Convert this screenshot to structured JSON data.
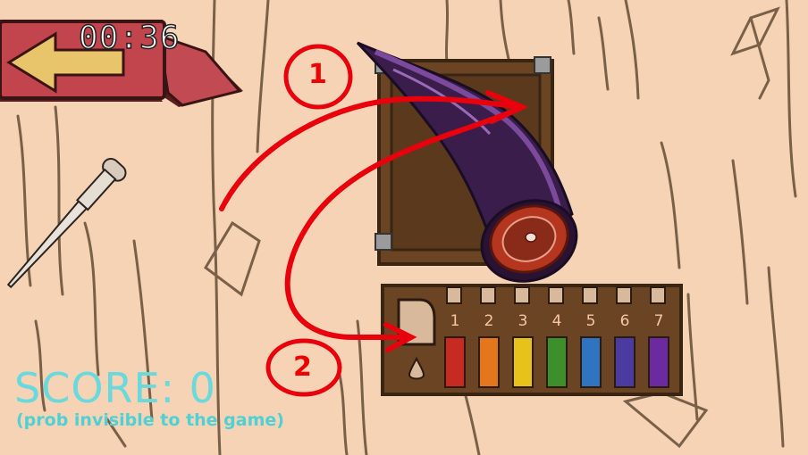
{
  "hud": {
    "timer": "00:36",
    "score_text": "SCORE: 0",
    "score_note": "(prob invisible to the game)"
  },
  "tray": {
    "slots": [
      {
        "label": "1",
        "color": "#c62a22"
      },
      {
        "label": "2",
        "color": "#e4761c"
      },
      {
        "label": "3",
        "color": "#e6c21a"
      },
      {
        "label": "4",
        "color": "#3c8f2a"
      },
      {
        "label": "5",
        "color": "#2f74c1"
      },
      {
        "label": "6",
        "color": "#4b3aa0"
      },
      {
        "label": "7",
        "color": "#6b2aa0"
      }
    ]
  },
  "annotations": {
    "step1": "1",
    "step2": "2"
  },
  "colors": {
    "background": "#f5d3b4",
    "score": "#6ad9dd",
    "arrow_red": "#e8000c"
  }
}
